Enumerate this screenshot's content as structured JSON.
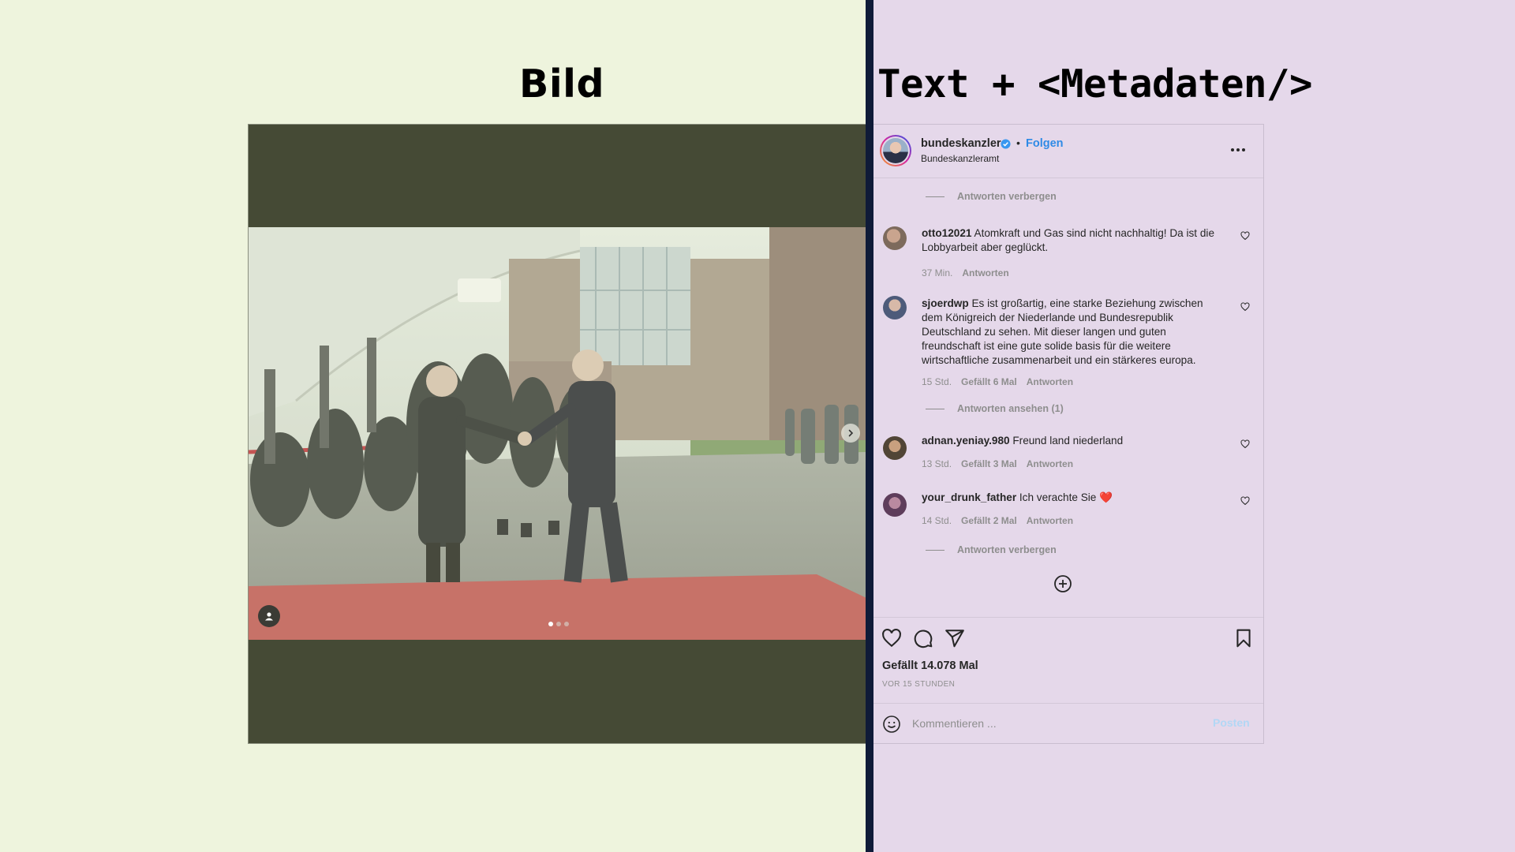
{
  "slide": {
    "left_title": "Bild",
    "right_title": "Text + <Metadaten/>",
    "colors": {
      "left_bg": "#eef4dd",
      "right_bg": "#e5d8ea",
      "divider": "#0f1b38",
      "image_bg": "#454a35",
      "accent_blue": "#2e8ae6",
      "muted_text": "#8e8e8e"
    }
  },
  "image_viewer": {
    "user_tag_icon": "person-icon",
    "next_icon": "chevron-right-icon",
    "carousel": {
      "total": 3,
      "active": 1
    }
  },
  "post": {
    "account": {
      "username": "bundeskanzler",
      "verified_icon": "verified-badge-icon",
      "separator": "•",
      "follow_label": "Folgen",
      "subtitle": "Bundeskanzleramt"
    },
    "more_icon": "more-horizontal-icon",
    "toggles": {
      "hide_replies_top": "Antworten verbergen",
      "view_replies": "Antworten ansehen (1)",
      "hide_replies_bottom": "Antworten verbergen"
    },
    "comments": [
      {
        "user": "otto12021",
        "text": "Atomkraft und Gas sind nicht nachhaltig! Da ist die Lobbyarbeit aber geglückt.",
        "time": "37 Min.",
        "likes": "",
        "reply": "Antworten"
      },
      {
        "user": "sjoerdwp",
        "text": "Es ist großartig, eine starke Beziehung zwischen dem Königreich der Niederlande und Bundesrepublik Deutschland zu sehen. Mit dieser langen und guten freundschaft ist eine gute solide basis für die weitere wirtschaftliche zusammenarbeit und ein stärkeres europa.",
        "time": "15 Std.",
        "likes": "Gefällt 6 Mal",
        "reply": "Antworten"
      },
      {
        "user": "adnan.yeniay.980",
        "text": "Freund land niederland",
        "time": "13 Std.",
        "likes": "Gefällt 3 Mal",
        "reply": "Antworten"
      },
      {
        "user": "your_drunk_father",
        "text": "Ich verachte Sie ❤️",
        "time": "14 Std.",
        "likes": "Gefällt 2 Mal",
        "reply": "Antworten"
      }
    ],
    "load_more_icon": "plus-circle-icon",
    "actions": {
      "like_icon": "heart-icon",
      "comment_icon": "comment-icon",
      "share_icon": "send-icon",
      "save_icon": "bookmark-icon"
    },
    "likes_count": "Gefällt 14.078 Mal",
    "posted_ago": "VOR 15 STUNDEN",
    "add_comment": {
      "emoji_icon": "emoji-icon",
      "placeholder": "Kommentieren ...",
      "post_label": "Posten"
    }
  }
}
